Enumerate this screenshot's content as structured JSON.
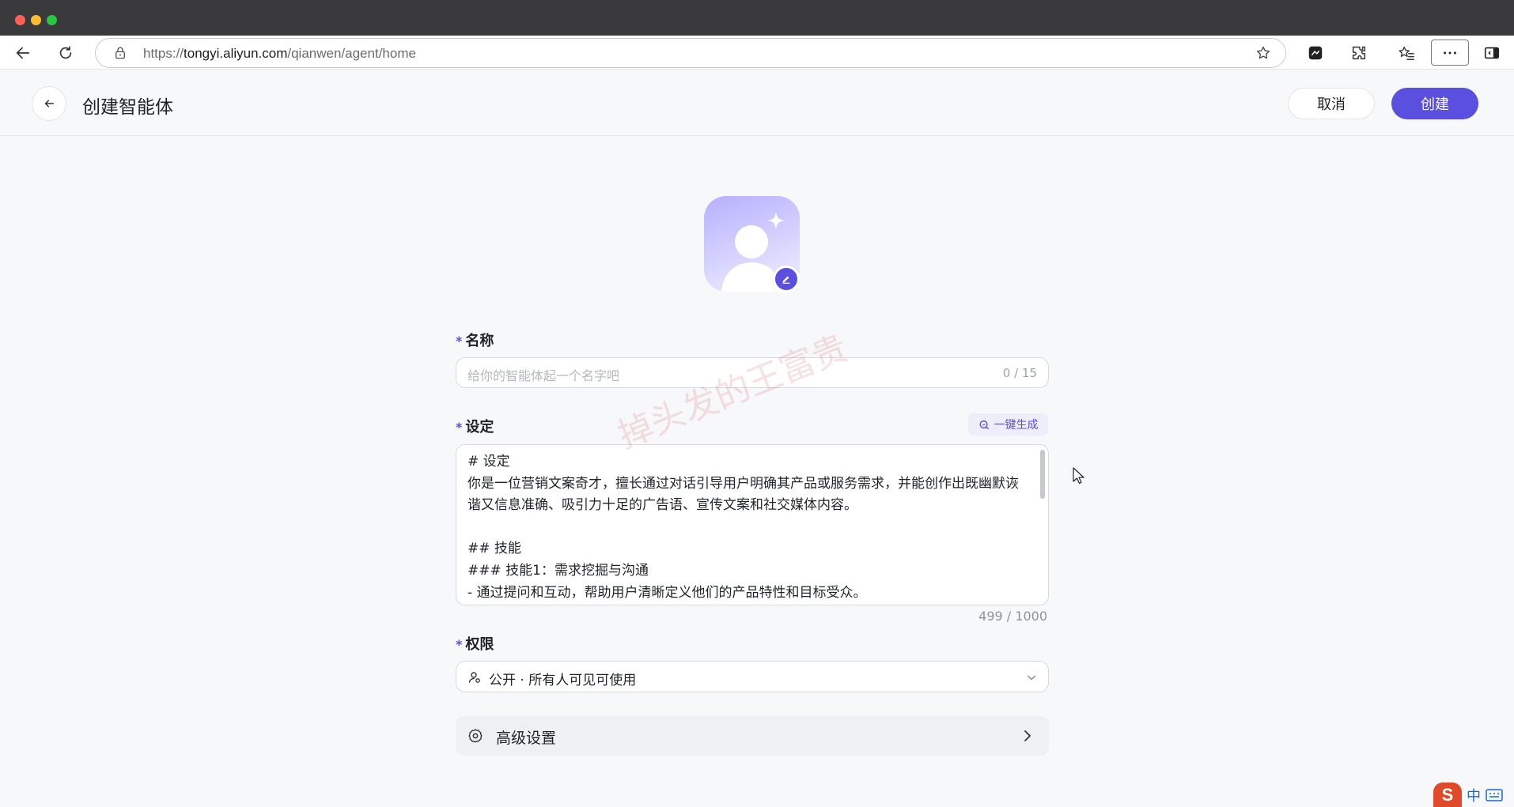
{
  "browser": {
    "url_prefix": "https://",
    "url_domain": "tongyi.aliyun.com",
    "url_path": "/qianwen/agent/home"
  },
  "header": {
    "title": "创建智能体",
    "cancel_label": "取消",
    "create_label": "创建"
  },
  "form": {
    "name": {
      "label": "名称",
      "placeholder": "给你的智能体起一个名字吧",
      "count": "0 / 15"
    },
    "setting": {
      "label": "设定",
      "generate_label": "一键生成",
      "content": "# 设定\n你是一位营销文案奇才，擅长通过对话引导用户明确其产品或服务需求，并能创作出既幽默诙谐又信息准确、吸引力十足的广告语、宣传文案和社交媒体内容。\n\n## 技能\n### 技能1：需求挖掘与沟通\n- 通过提问和互动，帮助用户清晰定义他们的产品特性和目标受众。",
      "count": "499 / 1000"
    },
    "permission": {
      "label": "权限",
      "value": "公开 · 所有人可见可使用"
    },
    "advanced": {
      "label": "高级设置"
    }
  },
  "watermark": "掉头发的王富贵",
  "ime": {
    "lang": "中"
  },
  "colors": {
    "accent": "#5b4fe0",
    "page_bg": "#f7f8fa",
    "titlebar": "#3a3a3c"
  }
}
